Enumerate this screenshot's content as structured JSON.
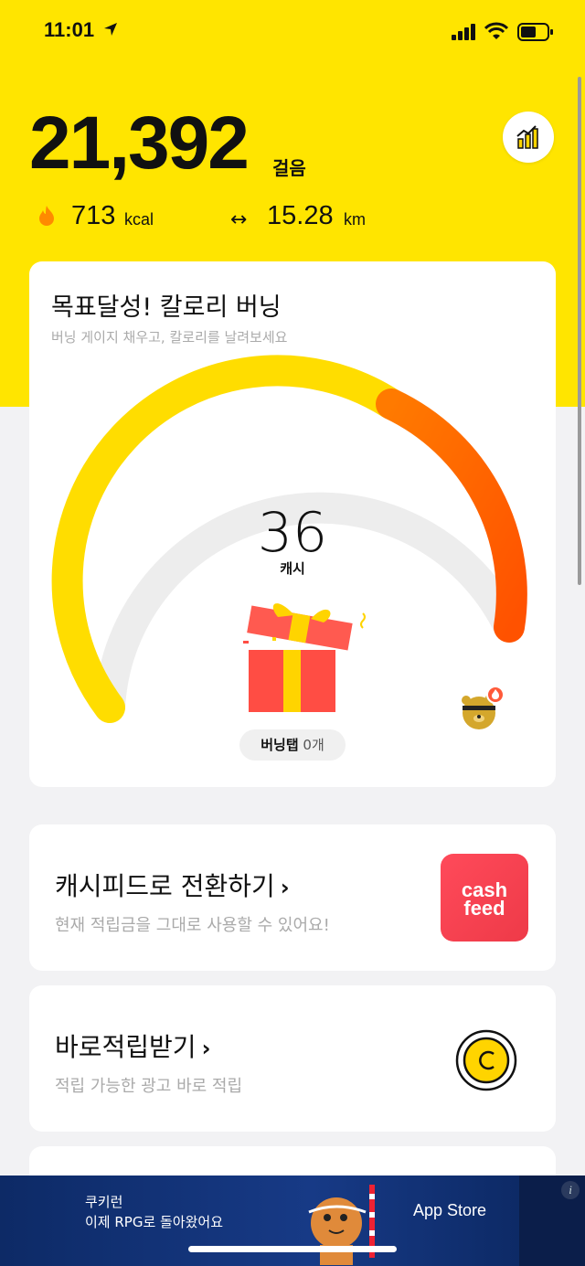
{
  "status_bar": {
    "time": "11:01"
  },
  "summary": {
    "steps": "21,392",
    "steps_unit": "걸음",
    "kcal_value": "713",
    "kcal_unit": "kcal",
    "distance_value": "15.28",
    "distance_unit": "km"
  },
  "burning": {
    "title": "목표달성! 칼로리 버닝",
    "subtitle": "버닝 게이지 채우고, 칼로리를 날려보세요",
    "cash_value": "36",
    "cash_unit": "캐시",
    "tap_label": "버닝탭",
    "tap_count": "0개",
    "gauge_fill": 0.9
  },
  "menu": [
    {
      "title": "캐시피드로 전환하기",
      "subtitle": "현재 적립금을 그대로 사용할 수 있어요!",
      "icon": "cashfeed-logo",
      "logo_line1": "cash",
      "logo_line2": "feed"
    },
    {
      "title": "바로적립받기",
      "subtitle": "적립 가능한 광고 바로 적립",
      "icon": "coin-icon"
    }
  ],
  "ad": {
    "line1": "쿠키런",
    "line2": "이제 RPG로 돌아왔어요",
    "store_label": "App Store",
    "info_label": "i"
  },
  "colors": {
    "brand_yellow": "#ffe500",
    "gauge_yellow": "#ffdd00",
    "gauge_orange": "#ff5a00",
    "cashfeed_red": "#ff4a5a"
  }
}
